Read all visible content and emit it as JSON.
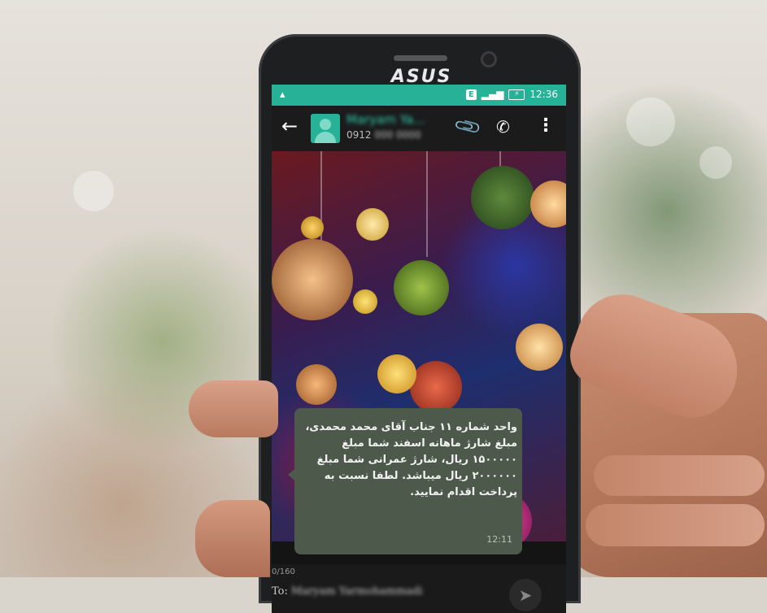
{
  "device": {
    "brand": "ASUS"
  },
  "statusbar": {
    "notification_icon": "notification-icon",
    "network_type": "E",
    "signal_icon": "signal-icon",
    "battery_icon": "battery-charging-icon",
    "time": "12:36"
  },
  "appbar": {
    "back_icon": "back-arrow-icon",
    "contact_name": "Maryam Ya...",
    "contact_number_prefix": "0912",
    "contact_number_rest": "000 0000",
    "attach_icon": "paperclip-icon",
    "call_icon": "phone-icon",
    "menu_icon": "more-vert-icon"
  },
  "message": {
    "text": "واحد شماره ۱۱ جناب آقای محمد محمدی، مبلغ شارژ ماهانه اسفند شما مبلغ ۱۵۰۰۰۰۰ ریال، شارژ عمرانی شما مبلغ ۲۰۰۰۰۰۰ ریال میباشد. لطفا نسبت به پرداخت اقدام نمایید.",
    "time": "12:11"
  },
  "compose": {
    "char_count": "0/160",
    "to_label": "To:",
    "to_value": "Maryam Yarmohammadi",
    "send_icon": "send-icon"
  },
  "colors": {
    "accent": "#27b196",
    "bubble": "#4d5a4b",
    "appbar": "#1b1b1c"
  }
}
